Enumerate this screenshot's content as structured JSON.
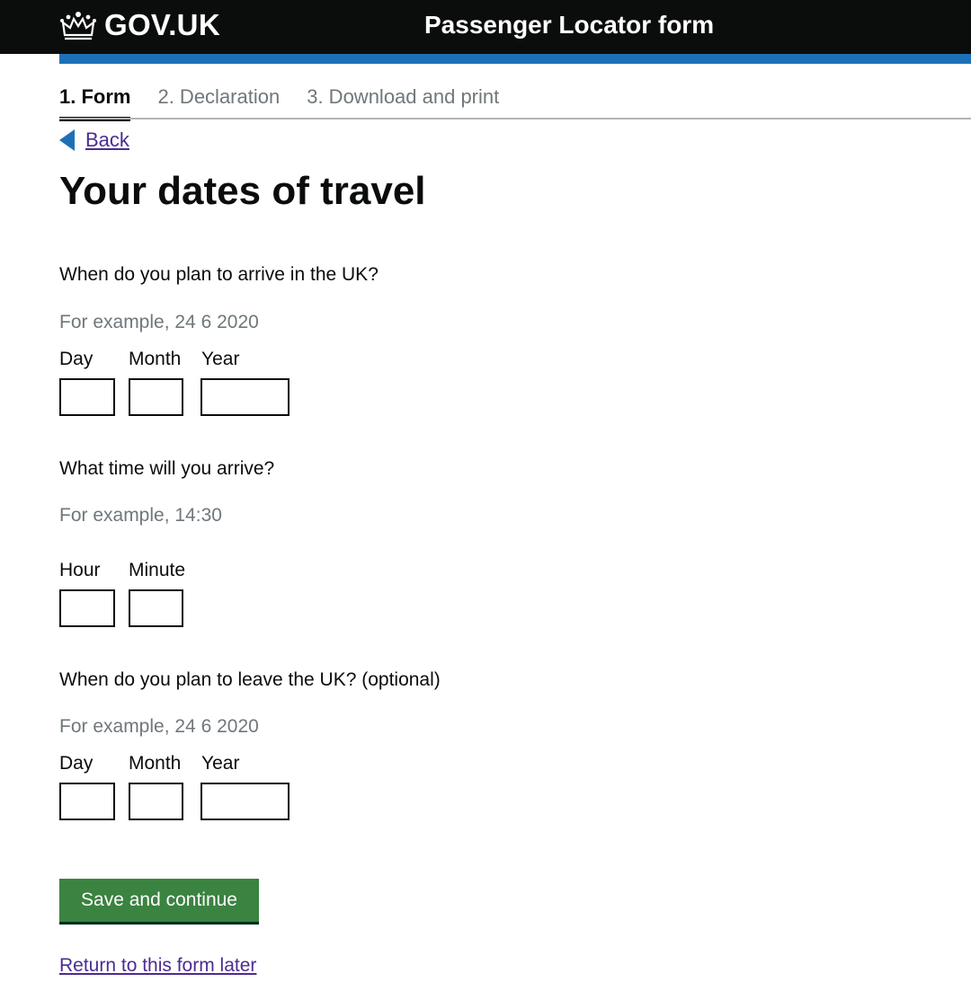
{
  "header": {
    "logo_text": "GOV.UK",
    "service_name": "Passenger Locator form"
  },
  "steps": [
    {
      "label": "1. Form",
      "active": true
    },
    {
      "label": "2. Declaration",
      "active": false
    },
    {
      "label": "3. Download and print",
      "active": false
    }
  ],
  "back_link": "Back",
  "page_title": "Your dates of travel",
  "arrival_date": {
    "question": "When do you plan to arrive in the UK?",
    "hint": "For example, 24 6 2020",
    "day_label": "Day",
    "month_label": "Month",
    "year_label": "Year",
    "day_value": "",
    "month_value": "",
    "year_value": ""
  },
  "arrival_time": {
    "question": "What time will you arrive?",
    "hint": "For example, 14:30",
    "hour_label": "Hour",
    "minute_label": "Minute",
    "hour_value": "",
    "minute_value": ""
  },
  "leave_date": {
    "question": "When do you plan to leave the UK? (optional)",
    "hint": "For example, 24 6 2020",
    "day_label": "Day",
    "month_label": "Month",
    "year_label": "Year",
    "day_value": "",
    "month_value": "",
    "year_value": ""
  },
  "actions": {
    "save_label": "Save and continue",
    "return_label": "Return to this form later"
  },
  "colors": {
    "header_bg": "#0b0c0c",
    "accent_blue": "#1d70b8",
    "button_green": "#3a8340",
    "link_purple": "#4c2c92",
    "hint_grey": "#6f777b"
  },
  "icons": {
    "logo": "crown-icon",
    "back": "back-arrow-icon"
  }
}
